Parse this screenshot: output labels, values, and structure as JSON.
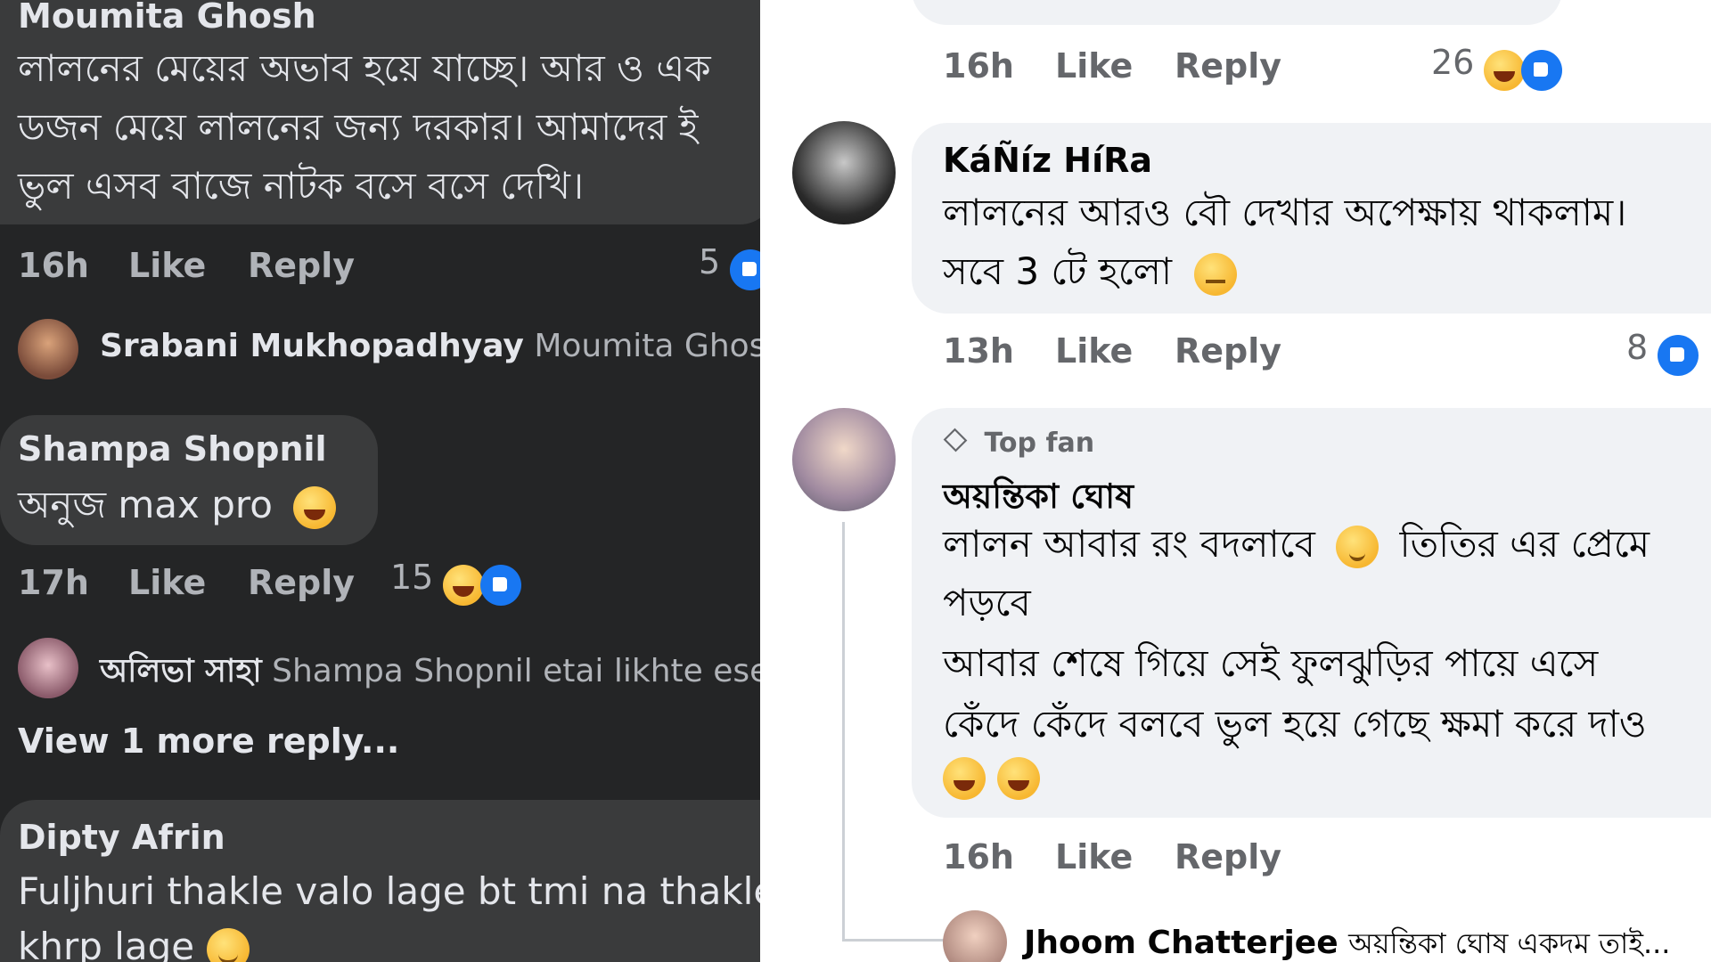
{
  "left": {
    "c1": {
      "author": "Moumita Ghosh",
      "lines": [
        "লালনের মেয়ের অভাব হয়ে যাচ্ছে। আর ও এক",
        "ডজন মেয়ে লালনের জন্য দরকার। আমাদের ই",
        "ভুল এসব বাজে নাটক বসে বসে দেখি।"
      ],
      "time": "16h",
      "like": "Like",
      "reply": "Reply",
      "reactions": "5"
    },
    "r1": {
      "author": "Srabani Mukhopadhyay",
      "text": "Moumita Ghosh th"
    },
    "c2": {
      "author": "Shampa Shopnil",
      "text": "অনুজ max pro",
      "time": "17h",
      "like": "Like",
      "reply": "Reply",
      "reactions": "15"
    },
    "r2": {
      "author": "অলিভা সাহা",
      "text": "Shampa Shopnil etai likhte ese"
    },
    "view_more": "View 1 more reply...",
    "c3": {
      "author": "Dipty Afrin",
      "lines": [
        "Fuljhuri thakle valo lage bt tmi na thakle",
        "khrp lage"
      ]
    }
  },
  "right": {
    "c0": {
      "time": "16h",
      "like": "Like",
      "reply": "Reply",
      "reactions": "26"
    },
    "c1": {
      "author": "KáÑíz HíRa",
      "lines": [
        "লালনের আরও বৌ দেখার অপেক্ষায় থাকলাম।",
        "সবে 3 টে হলো"
      ],
      "time": "13h",
      "like": "Like",
      "reply": "Reply",
      "reactions": "8"
    },
    "c2": {
      "badge": "Top fan",
      "author": "অয়ন্তিকা ঘোষ",
      "line1a": "লালন আবার রং বদলাবে",
      "line1b": "তিতির এর প্রেমে",
      "lines": [
        "পড়বে",
        "আবার শেষে গিয়ে সেই ফুলঝুড়ির পায়ে এসে",
        "কেঁদে কেঁদে বলবে ভুল হয়ে গেছে ক্ষমা করে দাও"
      ],
      "time": "16h",
      "like": "Like",
      "reply": "Reply"
    },
    "r1": {
      "author": "Jhoom Chatterjee",
      "text": "অয়ন্তিকা ঘোষ একদম তাই..."
    }
  },
  "icons": {
    "like": "like-reaction-icon",
    "haha": "haha-reaction-icon",
    "gem": "top-fan-gem-icon"
  }
}
